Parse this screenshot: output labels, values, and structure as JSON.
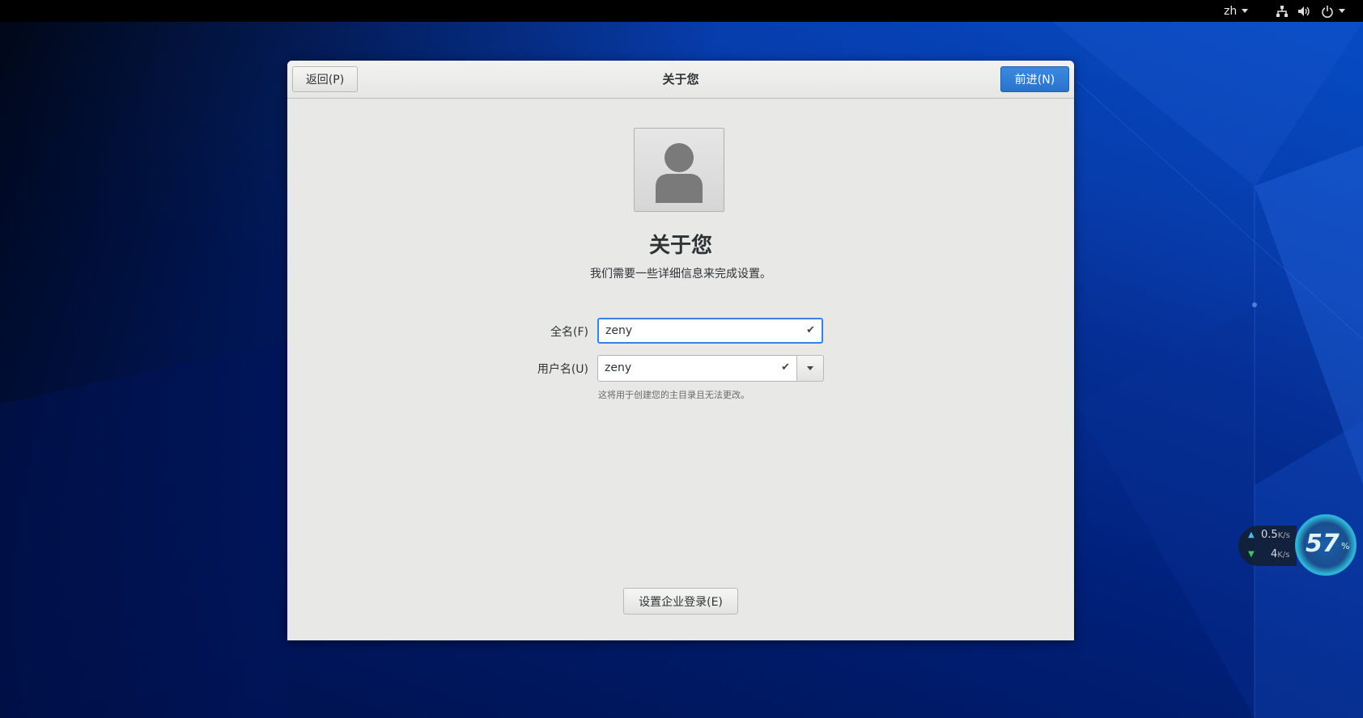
{
  "topbar": {
    "language": "zh",
    "network_icon": "network-wired-icon",
    "volume_icon": "volume-icon",
    "power_icon": "power-icon"
  },
  "window": {
    "back_label": "返回(P)",
    "title": "关于您",
    "next_label": "前进(N)"
  },
  "main": {
    "avatar_icon": "user-avatar-icon",
    "title": "关于您",
    "subtitle": "我们需要一些详细信息来完成设置。",
    "fullname": {
      "label": "全名(F)",
      "value": "zeny"
    },
    "username": {
      "label": "用户名(U)",
      "value": "zeny",
      "hint": "这将用于创建您的主目录且无法更改。"
    },
    "enterprise_login_label": "设置企业登录(E)"
  },
  "net_monitor": {
    "upload": "0.5",
    "upload_unit": "K/s",
    "download": "4",
    "download_unit": "K/s",
    "gauge_value": "57",
    "gauge_unit": "%"
  },
  "colors": {
    "accent": "#3584e4",
    "primary_button": "#2a72cc"
  }
}
